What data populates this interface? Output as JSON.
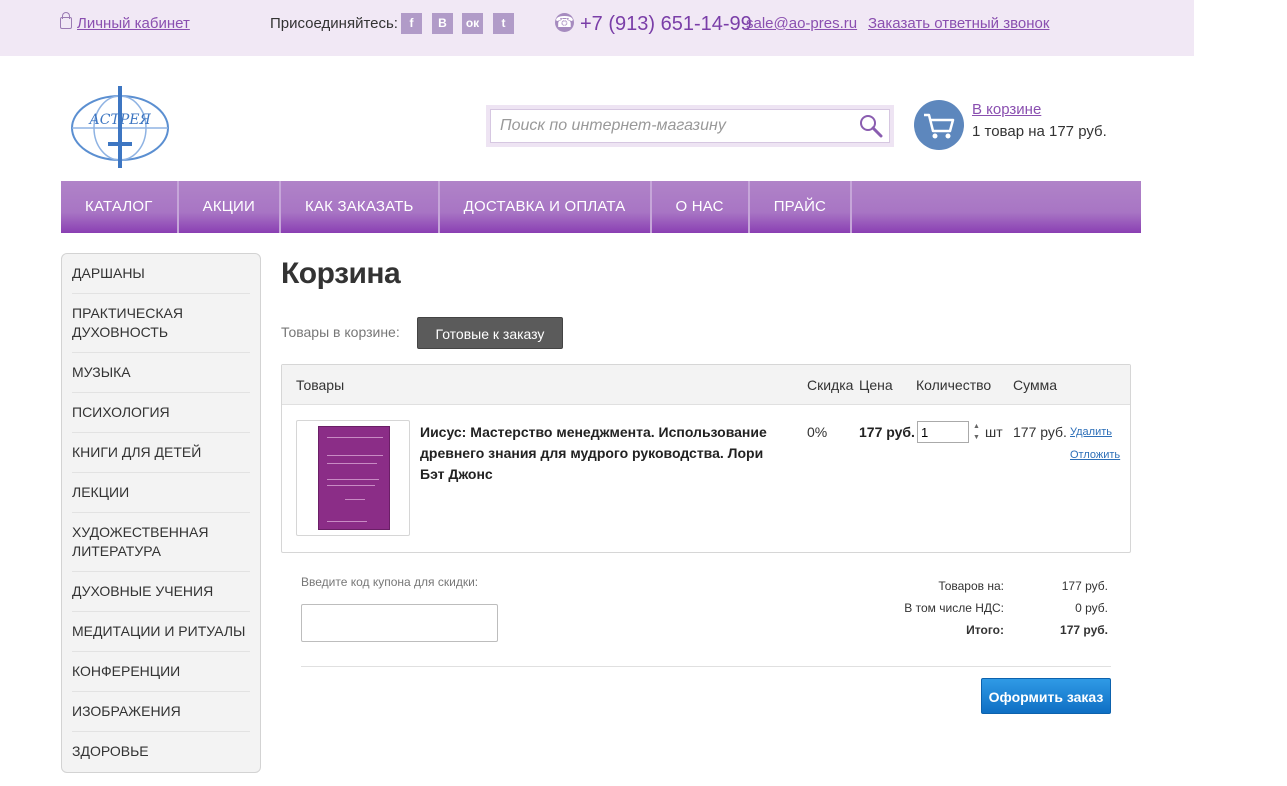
{
  "topbar": {
    "cabinet": "Личный кабинет",
    "join": "Присоединяйтесь:",
    "social": [
      {
        "icon": "facebook-icon",
        "glyph": "f"
      },
      {
        "icon": "vk-icon",
        "glyph": "B"
      },
      {
        "icon": "odnoklassniki-icon",
        "glyph": "ок"
      },
      {
        "icon": "twitter-icon",
        "glyph": "t"
      }
    ],
    "phone": "+7 (913) 651-14-99",
    "email": "sale@ao-pres.ru",
    "callback": "Заказать ответный звонок"
  },
  "header": {
    "logo_text": "АСТРЕЯ",
    "search_placeholder": "Поиск по интернет-магазину",
    "cart_link": "В корзине",
    "cart_info": "1 товар на 177 руб."
  },
  "nav": [
    "КАТАЛОГ",
    "АКЦИИ",
    "КАК ЗАКАЗАТЬ",
    "ДОСТАВКА И ОПЛАТА",
    "О НАС",
    "ПРАЙС"
  ],
  "sidebar": [
    "ДАРШАНЫ",
    "ПРАКТИЧЕСКАЯ ДУХОВНОСТЬ",
    "МУЗЫКА",
    "ПСИХОЛОГИЯ",
    "КНИГИ ДЛЯ ДЕТЕЙ",
    "ЛЕКЦИИ",
    "ХУДОЖЕСТВЕННАЯ ЛИТЕРАТУРА",
    "ДУХОВНЫЕ УЧЕНИЯ",
    "МЕДИТАЦИИ И РИТУАЛЫ",
    "КОНФЕРЕНЦИИ",
    "ИЗОБРАЖЕНИЯ",
    "ЗДОРОВЬЕ"
  ],
  "main": {
    "title": "Корзина",
    "basket_label": "Товары в корзине:",
    "ready_button": "Готовые к заказу",
    "table": {
      "headers": {
        "goods": "Товары",
        "discount": "Скидка",
        "price": "Цена",
        "quantity": "Количество",
        "sum": "Сумма"
      },
      "item": {
        "name": "Иисус: Мастерство менеджмента. Использование древнего знания для мудрого руководства. Лори Бэт Джонс",
        "discount": "0%",
        "price": "177 руб.",
        "quantity": "1",
        "unit": "шт",
        "sum": "177 руб.",
        "delete": "Удалить",
        "postpone": "Отложить"
      }
    },
    "coupon_label": "Введите код купона для скидки:",
    "totals": {
      "goods_label": "Товаров на:",
      "goods_value": "177 руб.",
      "vat_label": "В том числе НДС:",
      "vat_value": "0 руб.",
      "total_label": "Итого:",
      "total_value": "177 руб."
    },
    "order_button": "Оформить заказ"
  },
  "colors": {
    "accent": "#8a4fb0",
    "nav": "#a875c4",
    "order": "#1a7fd4"
  }
}
